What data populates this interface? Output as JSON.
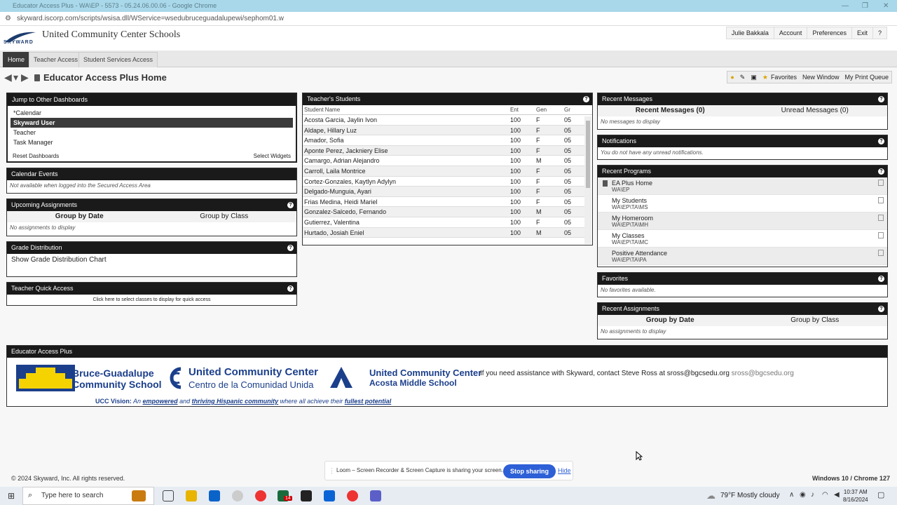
{
  "browser": {
    "title": "Educator Access Plus - WA\\EP - 5573 - 05.24.06.00.06 - Google Chrome",
    "url": "skyward.iscorp.com/scripts/wsisa.dll/WService=wsedubruceguadalupewi/sephom01.w"
  },
  "header": {
    "logo_text": "SKYWARD",
    "school_name": "United Community Center Schools",
    "links": [
      "Julie Bakkala",
      "Account",
      "Preferences",
      "Exit",
      "?"
    ]
  },
  "nav": {
    "tabs": [
      "Home",
      "Teacher Access",
      "Student Services Access"
    ]
  },
  "page": {
    "title": "Educator Access Plus Home"
  },
  "toolbar": {
    "favorites": "Favorites",
    "new_window": "New Window",
    "print_queue": "My Print Queue"
  },
  "dashboards": {
    "title": "Jump to Other Dashboards",
    "items": [
      "*Calendar",
      "Skyward User",
      "Teacher",
      "Task Manager"
    ],
    "reset": "Reset Dashboards",
    "select": "Select Widgets"
  },
  "calendar": {
    "title": "Calendar Events",
    "note": "Not available when logged into the Secured Access Area"
  },
  "upcoming": {
    "title": "Upcoming Assignments",
    "by_date": "Group by Date",
    "by_class": "Group by Class",
    "note": "No assignments to display"
  },
  "grades": {
    "title": "Grade Distribution",
    "link": "Show Grade Distribution Chart"
  },
  "quick": {
    "title": "Teacher Quick Access",
    "note": "Click here to select classes to display for quick access"
  },
  "students": {
    "title": "Teacher's Students",
    "columns": [
      "Student Name",
      "Ent",
      "Gen",
      "Gr"
    ],
    "rows": [
      [
        "Acosta Garcia, Jaylin Ivon",
        "100",
        "F",
        "05"
      ],
      [
        "Aldape, Hillary Luz",
        "100",
        "F",
        "05"
      ],
      [
        "Amador, Sofia",
        "100",
        "F",
        "05"
      ],
      [
        "Aponte Perez, Jackniery Elise",
        "100",
        "F",
        "05"
      ],
      [
        "Camargo, Adrian Alejandro",
        "100",
        "M",
        "05"
      ],
      [
        "Carroll, Laila Montrice",
        "100",
        "F",
        "05"
      ],
      [
        "Cortez-Gonzales, Kaytlyn Adylyn",
        "100",
        "F",
        "05"
      ],
      [
        "Delgado-Munguia, Ayari",
        "100",
        "F",
        "05"
      ],
      [
        "Frias Medina, Heidi Mariel",
        "100",
        "F",
        "05"
      ],
      [
        "Gonzalez-Salcedo, Fernando",
        "100",
        "M",
        "05"
      ],
      [
        "Gutierrez, Valentina",
        "100",
        "F",
        "05"
      ],
      [
        "Hurtado, Josiah Eniel",
        "100",
        "M",
        "05"
      ]
    ]
  },
  "messages": {
    "title": "Recent Messages",
    "recent": "Recent Messages (0)",
    "unread": "Unread Messages (0)",
    "note": "No messages to display"
  },
  "notifications": {
    "title": "Notifications",
    "note": "You do not have any unread notifications."
  },
  "programs": {
    "title": "Recent Programs",
    "items": [
      {
        "name": "EA Plus Home",
        "code": "WA\\EP"
      },
      {
        "name": "My Students",
        "code": "WA\\EP\\TA\\MS"
      },
      {
        "name": "My Homeroom",
        "code": "WA\\EP\\TA\\MH"
      },
      {
        "name": "My Classes",
        "code": "WA\\EP\\TA\\MC"
      },
      {
        "name": "Positive Attendance",
        "code": "WA\\EP\\TA\\PA"
      }
    ]
  },
  "favorites": {
    "title": "Favorites",
    "note": "No favorites available."
  },
  "recent_assign": {
    "title": "Recent Assignments",
    "by_date": "Group by Date",
    "by_class": "Group by Class",
    "note": "No assignments to display"
  },
  "banner": {
    "title": "Educator Access Plus",
    "logo1_line1": "Bruce-Guadalupe",
    "logo1_line2": "Community School",
    "logo2_line1": "United Community Center",
    "logo2_line2": "Centro de la Comunidad Unida",
    "logo3_line1": "United Community Center",
    "logo3_line2": "Acosta Middle School",
    "assist": "If you need assistance with Skyward, contact Steve Ross at sross@bgcsedu.org",
    "assist_email": "sross@bgcsedu.org",
    "vision_label": "UCC Vision:",
    "vision_1": "An",
    "vision_2": "empowered",
    "vision_3": "and",
    "vision_4": "thriving Hispanic community",
    "vision_5": "where all achieve their",
    "vision_6": "fullest potential"
  },
  "footer": {
    "copyright": "© 2024 Skyward, Inc. All rights reserved.",
    "platform": "Windows 10 / Chrome 127"
  },
  "loom": {
    "message": "Loom – Screen Recorder & Screen Capture is sharing your screen.",
    "stop": "Stop sharing",
    "hide": "Hide"
  },
  "taskbar": {
    "search": "Type here to search",
    "weather": "79°F  Mostly cloudy",
    "time": "10:37 AM",
    "date": "8/16/2024",
    "badge": "14"
  }
}
